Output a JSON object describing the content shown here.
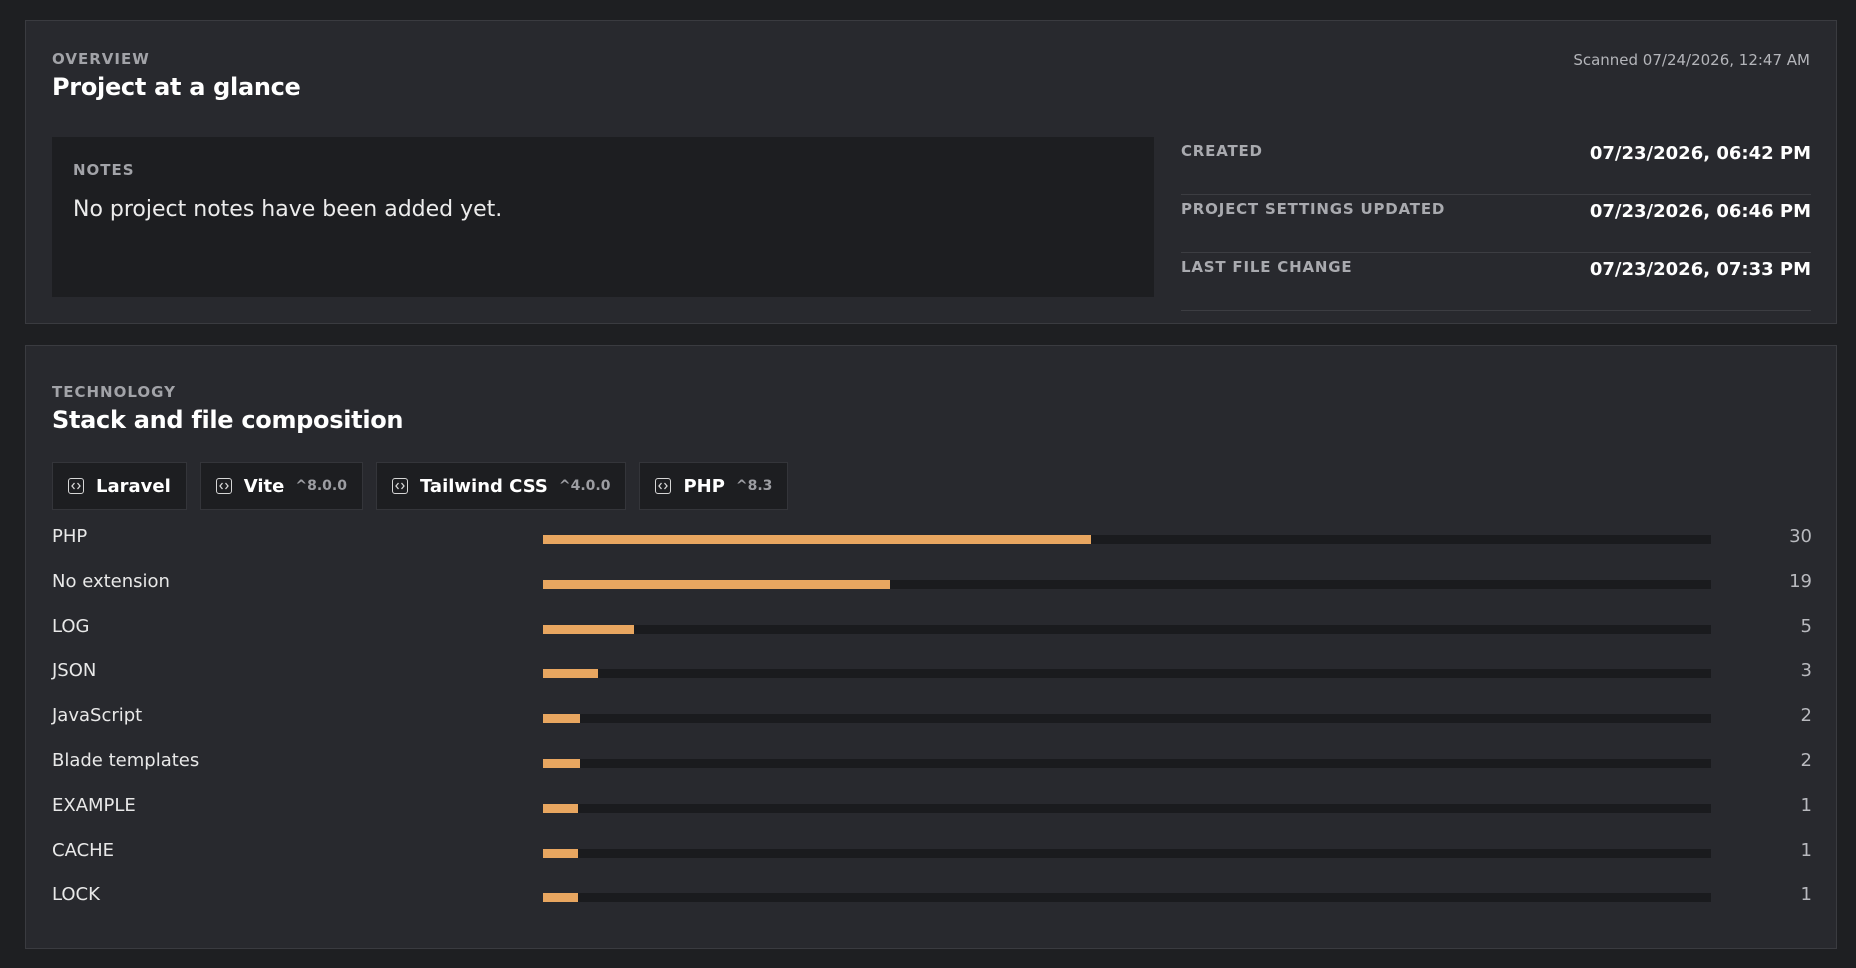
{
  "overview": {
    "eyebrow": "OVERVIEW",
    "title": "Project at a glance",
    "scanned": "Scanned 07/24/2026, 12:47 AM",
    "notes": {
      "label": "NOTES",
      "text": "No project notes have been added yet."
    },
    "meta": [
      {
        "label": "CREATED",
        "value": "07/23/2026, 06:42 PM"
      },
      {
        "label": "PROJECT SETTINGS UPDATED",
        "value": "07/23/2026, 06:46 PM"
      },
      {
        "label": "LAST FILE CHANGE",
        "value": "07/23/2026, 07:33 PM"
      }
    ]
  },
  "technology": {
    "eyebrow": "TECHNOLOGY",
    "title": "Stack and file composition",
    "stack": [
      {
        "name": "Laravel",
        "version": "",
        "icon": "code-icon"
      },
      {
        "name": "Vite",
        "version": "^8.0.0",
        "icon": "code-icon"
      },
      {
        "name": "Tailwind CSS",
        "version": "^4.0.0",
        "icon": "code-icon"
      },
      {
        "name": "PHP",
        "version": "^8.3",
        "icon": "code-icon"
      }
    ],
    "files": [
      {
        "label": "PHP",
        "count": 30
      },
      {
        "label": "No extension",
        "count": 19
      },
      {
        "label": "LOG",
        "count": 5
      },
      {
        "label": "JSON",
        "count": 3
      },
      {
        "label": "JavaScript",
        "count": 2
      },
      {
        "label": "Blade templates",
        "count": 2
      },
      {
        "label": "EXAMPLE",
        "count": 1
      },
      {
        "label": "CACHE",
        "count": 1
      },
      {
        "label": "LOCK",
        "count": 1
      }
    ],
    "bar_scale_max": 64
  },
  "colors": {
    "background": "#1e1f22",
    "panel": "#28292e",
    "bar_fill": "#e8a660",
    "bar_track": "#1a1b1e"
  }
}
